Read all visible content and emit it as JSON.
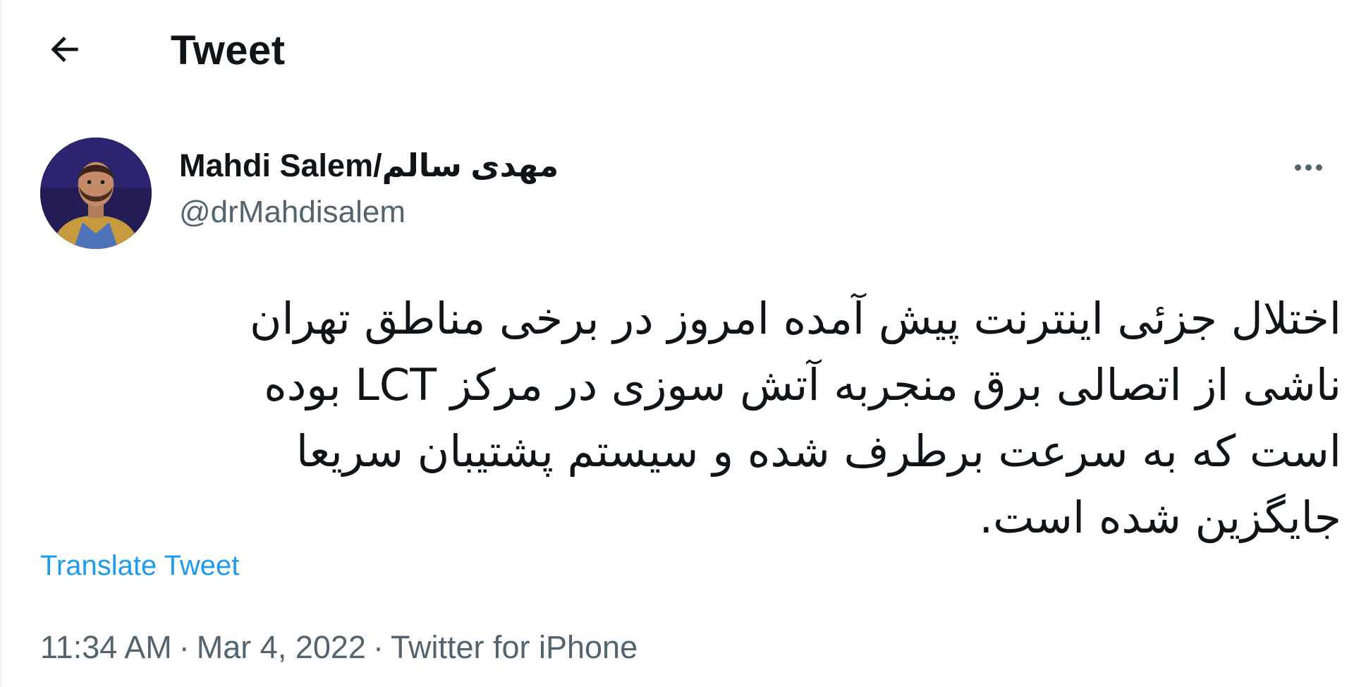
{
  "header": {
    "title": "Tweet",
    "back_icon": "arrow-left-icon"
  },
  "tweet": {
    "author": {
      "name": "Mahdi Salem/مهدی سالم",
      "handle": "@drMahdisalem",
      "avatar_icon": "user-avatar"
    },
    "more_icon": "more-horizontal-icon",
    "lines": [
      "اختلال جزئی اینترنت پیش آمده امروز در برخی مناطق تهران",
      "ناشی از اتصالی برق منجربه آتش سوزی در مرکز LCT بوده",
      "است که به سرعت برطرف شده و سیستم پشتیبان سریعا",
      "جایگزین شده است."
    ],
    "translate_label": "Translate Tweet",
    "time": "11:34 AM",
    "date": "Mar 4, 2022",
    "separator": "·",
    "source": "Twitter for iPhone"
  },
  "colors": {
    "text_primary": "#0f1419",
    "text_secondary": "#536471",
    "link": "#1d9bf0"
  }
}
